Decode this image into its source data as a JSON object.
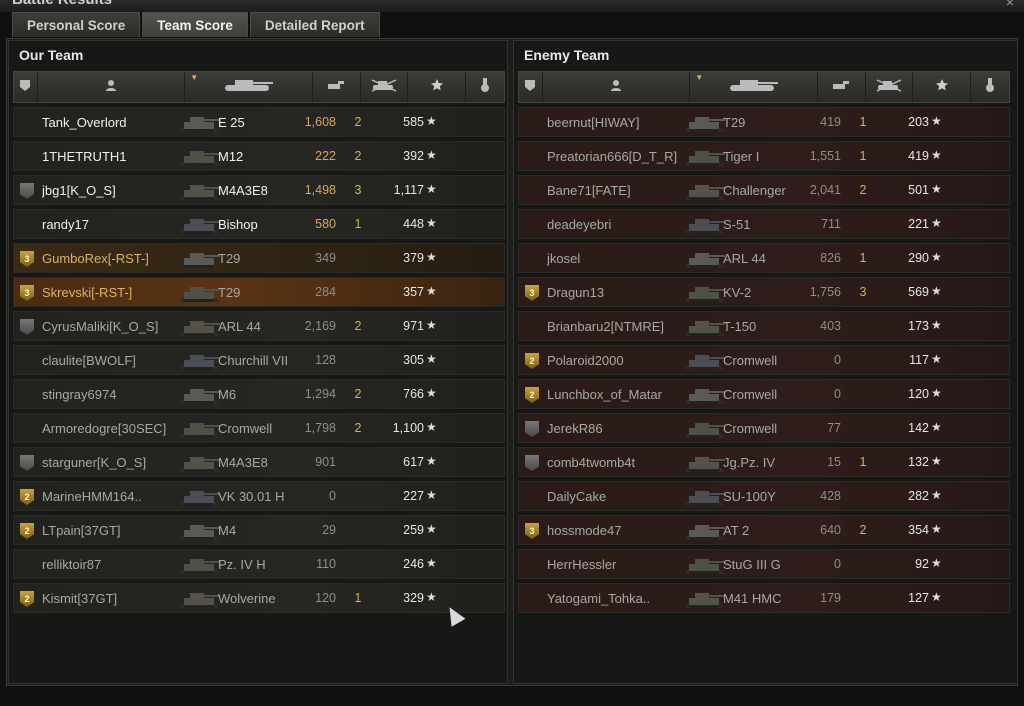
{
  "window": {
    "title": "Battle Results",
    "close": "×"
  },
  "tabs": [
    {
      "label": "Personal Score",
      "active": false
    },
    {
      "label": "Team Score",
      "active": true
    },
    {
      "label": "Detailed Report",
      "active": false
    }
  ],
  "columns": [
    "squad",
    "player",
    "tank",
    "damage",
    "kills",
    "xp",
    "medals"
  ],
  "our_team": {
    "title": "Our Team",
    "rows": [
      {
        "squad": "",
        "player": "Tank_Overlord",
        "tank": "E 25",
        "damage": "1,608",
        "kills": "2",
        "xp": "585",
        "style": "alive"
      },
      {
        "squad": "",
        "player": "1THETRUTH1",
        "tank": "M12",
        "damage": "222",
        "kills": "2",
        "xp": "392",
        "style": "alive"
      },
      {
        "squad": "icon",
        "player": "jbg1[K_O_S]",
        "tank": "M4A3E8",
        "damage": "1,498",
        "kills": "3",
        "xp": "1,117",
        "style": "alive"
      },
      {
        "squad": "",
        "player": "randy17",
        "tank": "Bishop",
        "damage": "580",
        "kills": "1",
        "xp": "448",
        "style": "alive"
      },
      {
        "squad": "3",
        "player": "GumboRex[-RST-]",
        "tank": "T29",
        "damage": "349",
        "kills": "",
        "xp": "379",
        "style": "squad"
      },
      {
        "squad": "3",
        "player": "Skrevski[-RST-]",
        "tank": "T29",
        "damage": "284",
        "kills": "",
        "xp": "357",
        "style": "mine"
      },
      {
        "squad": "icon",
        "player": "CyrusMaliki[K_O_S]",
        "tank": "ARL 44",
        "damage": "2,169",
        "kills": "2",
        "xp": "971",
        "style": "dead"
      },
      {
        "squad": "",
        "player": "claulite[BWOLF]",
        "tank": "Churchill VII",
        "damage": "128",
        "kills": "",
        "xp": "305",
        "style": "dead"
      },
      {
        "squad": "",
        "player": "stingray6974",
        "tank": "M6",
        "damage": "1,294",
        "kills": "2",
        "xp": "766",
        "style": "dead"
      },
      {
        "squad": "",
        "player": "Armoredogre[30SEC]",
        "tank": "Cromwell",
        "damage": "1,798",
        "kills": "2",
        "xp": "1,100",
        "style": "dead"
      },
      {
        "squad": "icon",
        "player": "starguner[K_O_S]",
        "tank": "M4A3E8",
        "damage": "901",
        "kills": "",
        "xp": "617",
        "style": "dead"
      },
      {
        "squad": "2",
        "player": "MarineHMM164..",
        "tank": "VK 30.01 H",
        "damage": "0",
        "kills": "",
        "xp": "227",
        "style": "dead"
      },
      {
        "squad": "2",
        "player": "LTpain[37GT]",
        "tank": "M4",
        "damage": "29",
        "kills": "",
        "xp": "259",
        "style": "dead"
      },
      {
        "squad": "",
        "player": "relliktoir87",
        "tank": "Pz. IV H",
        "damage": "110",
        "kills": "",
        "xp": "246",
        "style": "dead"
      },
      {
        "squad": "2",
        "player": "Kismit[37GT]",
        "tank": "Wolverine",
        "damage": "120",
        "kills": "1",
        "xp": "329",
        "style": "dead"
      }
    ]
  },
  "enemy_team": {
    "title": "Enemy Team",
    "rows": [
      {
        "squad": "",
        "player": "beernut[HIWAY]",
        "tank": "T29",
        "damage": "419",
        "kills": "1",
        "xp": "203",
        "style": "dead"
      },
      {
        "squad": "",
        "player": "Preatorian666[D_T_R]",
        "tank": "Tiger I",
        "damage": "1,551",
        "kills": "1",
        "xp": "419",
        "style": "dead"
      },
      {
        "squad": "",
        "player": "Bane71[FATE]",
        "tank": "Challenger",
        "damage": "2,041",
        "kills": "2",
        "xp": "501",
        "style": "dead"
      },
      {
        "squad": "",
        "player": "deadeyebri",
        "tank": "S-51",
        "damage": "711",
        "kills": "",
        "xp": "221",
        "style": "dead"
      },
      {
        "squad": "",
        "player": "jkosel",
        "tank": "ARL 44",
        "damage": "826",
        "kills": "1",
        "xp": "290",
        "style": "dead"
      },
      {
        "squad": "3",
        "player": "Dragun13",
        "tank": "KV-2",
        "damage": "1,756",
        "kills": "3",
        "xp": "569",
        "style": "dead"
      },
      {
        "squad": "",
        "player": "Brianbaru2[NTMRE]",
        "tank": "T-150",
        "damage": "403",
        "kills": "",
        "xp": "173",
        "style": "dead"
      },
      {
        "squad": "2",
        "player": "Polaroid2000",
        "tank": "Cromwell",
        "damage": "0",
        "kills": "",
        "xp": "117",
        "style": "dead"
      },
      {
        "squad": "2",
        "player": "Lunchbox_of_Matar",
        "tank": "Cromwell",
        "damage": "0",
        "kills": "",
        "xp": "120",
        "style": "dead"
      },
      {
        "squad": "icon",
        "player": "JerekR86",
        "tank": "Cromwell",
        "damage": "77",
        "kills": "",
        "xp": "142",
        "style": "dead"
      },
      {
        "squad": "icon",
        "player": "comb4twomb4t",
        "tank": "Jg.Pz. IV",
        "damage": "15",
        "kills": "1",
        "xp": "132",
        "style": "dead"
      },
      {
        "squad": "",
        "player": "DailyCake",
        "tank": "SU-100Y",
        "damage": "428",
        "kills": "",
        "xp": "282",
        "style": "dead"
      },
      {
        "squad": "3",
        "player": "hossmode47",
        "tank": "AT 2",
        "damage": "640",
        "kills": "2",
        "xp": "354",
        "style": "dead"
      },
      {
        "squad": "",
        "player": "HerrHessler",
        "tank": "StuG III G",
        "damage": "0",
        "kills": "",
        "xp": "92",
        "style": "dead"
      },
      {
        "squad": "",
        "player": "Yatogami_Tohka..",
        "tank": "M41 HMC",
        "damage": "179",
        "kills": "",
        "xp": "127",
        "style": "dead"
      }
    ]
  },
  "colors": {
    "alive_text": "#f0f0f0",
    "dead_text": "#a8a8a8",
    "squad_text": "#e0b35a",
    "accent_gold": "#d6b15c",
    "our_row_bg": "#24241f",
    "enemy_row_bg": "#2e1d1a"
  },
  "icons": {
    "squad_header": "squad-icon",
    "player_header": "player-icon",
    "tank_header": "tank-icon",
    "damage_header": "gun-icon",
    "kills_header": "destroyed-tank-icon",
    "xp_header": "star-icon",
    "medals_header": "medal-icon",
    "xp_suffix": "★"
  }
}
